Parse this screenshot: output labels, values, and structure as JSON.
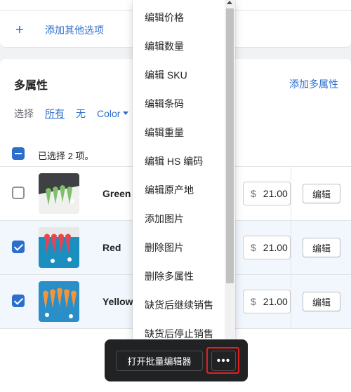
{
  "options_card": {
    "add_option_icon": "plus-icon",
    "add_option_label": "添加其他选项"
  },
  "variants": {
    "title": "多属性",
    "add_variants_label": "添加多属性",
    "select": {
      "label": "选择",
      "all": "所有",
      "none": "无",
      "color": "Color",
      "color_icon": "caret-down-icon"
    },
    "selected_text": "已选择 2 项。",
    "rows": [
      {
        "name": "Green",
        "currency": "$",
        "price": "21.00",
        "edit": "编辑",
        "selected": false
      },
      {
        "name": "Red",
        "currency": "$",
        "price": "21.00",
        "edit": "编辑",
        "selected": true
      },
      {
        "name": "Yellow",
        "currency": "$",
        "price": "21.00",
        "edit": "编辑",
        "selected": true
      }
    ]
  },
  "menu": {
    "items": [
      "编辑价格",
      "编辑数量",
      "编辑 SKU",
      "编辑条码",
      "编辑重量",
      "编辑 HS 编码",
      "编辑原产地",
      "添加图片",
      "删除图片",
      "删除多属性",
      "缺货后继续销售",
      "缺货后停止销售"
    ]
  },
  "bulk_bar": {
    "open_editor": "打开批量编辑器",
    "more_icon": "ellipsis-icon",
    "more_label": "•••"
  },
  "colors": {
    "accent": "#2c6ecb",
    "highlight_outline": "#e02020",
    "bar_bg": "#202223"
  }
}
